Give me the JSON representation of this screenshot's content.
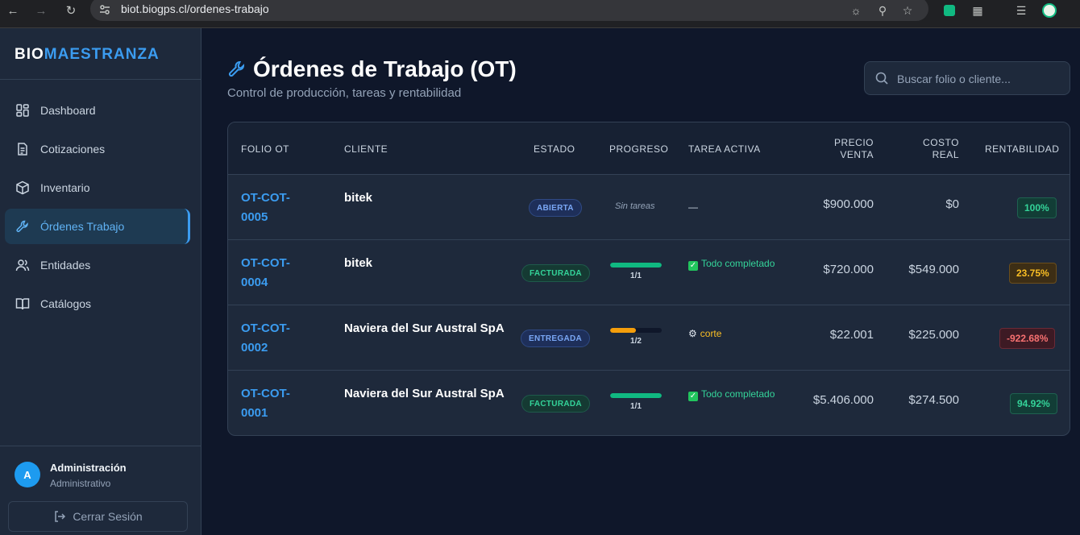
{
  "browser": {
    "url": "biot.biogps.cl/ordenes-trabajo"
  },
  "sidebar": {
    "brand_part1": "BIO",
    "brand_part2": "MAESTRANZA",
    "items": [
      {
        "label": "Dashboard",
        "icon": "dashboard-icon"
      },
      {
        "label": "Cotizaciones",
        "icon": "document-icon"
      },
      {
        "label": "Inventario",
        "icon": "box-icon"
      },
      {
        "label": "Órdenes Trabajo",
        "icon": "wrench-icon",
        "active": true
      },
      {
        "label": "Entidades",
        "icon": "users-icon"
      },
      {
        "label": "Catálogos",
        "icon": "book-icon"
      }
    ],
    "user": {
      "initial": "A",
      "name": "Administración",
      "role": "Administrativo"
    },
    "logout_label": "Cerrar Sesión"
  },
  "header": {
    "title": "Órdenes de Trabajo (OT)",
    "subtitle": "Control de producción, tareas y rentabilidad",
    "search_placeholder": "Buscar folio o cliente..."
  },
  "table": {
    "columns": {
      "folio": "FOLIO OT",
      "cliente": "CLIENTE",
      "estado": "ESTADO",
      "progreso": "PROGRESO",
      "tarea": "TAREA ACTIVA",
      "precio_1": "PRECIO",
      "precio_2": "VENTA",
      "costo_1": "COSTO",
      "costo_2": "REAL",
      "rentabilidad": "RENTABILIDAD"
    },
    "rows": [
      {
        "folio_1": "OT-COT-",
        "folio_2": "0005",
        "cliente": "bitek",
        "estado": "ABIERTA",
        "progreso_text": "Sin tareas",
        "tarea": "—",
        "precio": "$900.000",
        "costo": "$0",
        "rentabilidad": "100%"
      },
      {
        "folio_1": "OT-COT-",
        "folio_2": "0004",
        "cliente": "bitek",
        "estado": "FACTURADA",
        "progreso_fraction": 1.0,
        "progreso_label": "1/1",
        "tarea": "Todo completado",
        "precio": "$720.000",
        "costo": "$549.000",
        "rentabilidad": "23.75%"
      },
      {
        "folio_1": "OT-COT-",
        "folio_2": "0002",
        "cliente": "Naviera del Sur Austral SpA",
        "estado": "ENTREGADA",
        "progreso_fraction": 0.5,
        "progreso_label": "1/2",
        "tarea": "corte",
        "precio": "$22.001",
        "costo": "$225.000",
        "rentabilidad": "-922.68%"
      },
      {
        "folio_1": "OT-COT-",
        "folio_2": "0001",
        "cliente": "Naviera del Sur Austral SpA",
        "estado": "FACTURADA",
        "progreso_fraction": 1.0,
        "progreso_label": "1/1",
        "tarea": "Todo completado",
        "precio": "$5.406.000",
        "costo": "$274.500",
        "rentabilidad": "94.92%"
      }
    ]
  },
  "colors": {
    "accent": "#3b9cf0",
    "success": "#34d399",
    "warning": "#fbbf24",
    "danger": "#f87171",
    "background": "#0f172a"
  }
}
